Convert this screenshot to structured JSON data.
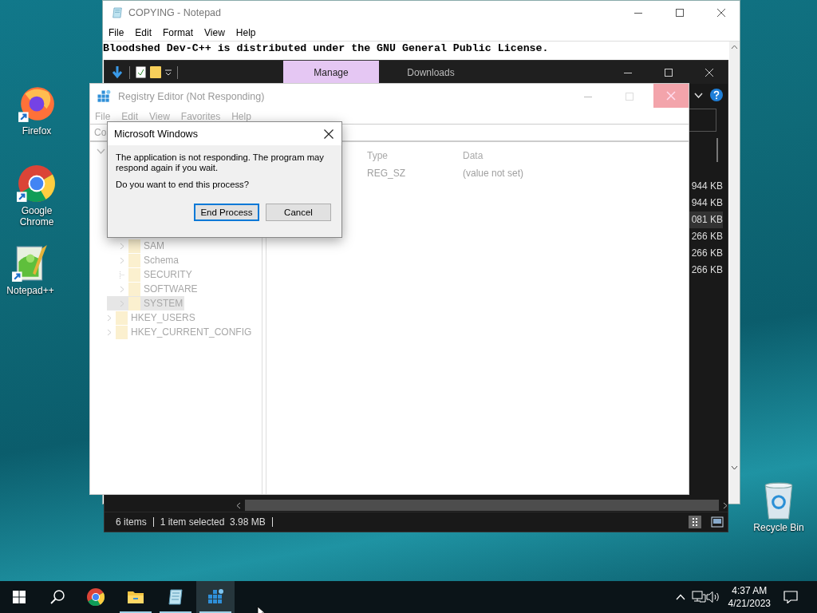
{
  "desktop_icons": [
    {
      "label": "Firefox",
      "kind": "firefox"
    },
    {
      "label": "Google Chrome",
      "kind": "chrome"
    },
    {
      "label": "Notepad++",
      "kind": "notepadpp"
    },
    {
      "label": "Recycle Bin",
      "kind": "recycle"
    }
  ],
  "notepad": {
    "title": "COPYING - Notepad",
    "menu": [
      "File",
      "Edit",
      "Format",
      "View",
      "Help"
    ],
    "lines": [
      "Bloodshed Dev-C++ is distributed under the GNU General Public License."
    ]
  },
  "explorer": {
    "tabs": [
      {
        "label": "Manage",
        "selected": true
      },
      {
        "label": "Downloads",
        "selected": false
      }
    ],
    "sizes": [
      {
        "text": "944 KB",
        "selected": false
      },
      {
        "text": "944 KB",
        "selected": false
      },
      {
        "text": "081 KB",
        "selected": true
      },
      {
        "text": "266 KB",
        "selected": false
      },
      {
        "text": "266 KB",
        "selected": false
      },
      {
        "text": "266 KB",
        "selected": false
      }
    ],
    "status": [
      "6 items",
      "1 item selected  3.98 MB"
    ]
  },
  "regedit": {
    "title": "Registry Editor (Not Responding)",
    "menu": [
      "File",
      "Edit",
      "View",
      "Favorites",
      "Help"
    ],
    "address": "Co",
    "tree": [
      {
        "children": [
          {
            "label": "SAM",
            "expandable": true,
            "selected": false
          },
          {
            "label": "Schema",
            "expandable": true,
            "selected": false
          },
          {
            "label": "SECURITY",
            "expandable": false,
            "selected": false
          },
          {
            "label": "SOFTWARE",
            "expandable": true,
            "selected": false
          },
          {
            "label": "SYSTEM",
            "expandable": true,
            "selected": true
          }
        ]
      },
      {
        "label": "HKEY_USERS",
        "expandable": true,
        "selected": false
      },
      {
        "label": "HKEY_CURRENT_CONFIG",
        "expandable": true,
        "selected": false
      }
    ],
    "columns": [
      "Type",
      "Data"
    ],
    "rows": [
      [
        "REG_SZ",
        "(value not set)"
      ]
    ]
  },
  "dialog": {
    "title": "Microsoft Windows",
    "message": "The application is not responding. The program may respond again if you wait.",
    "question": "Do you want to end this process?",
    "buttons": [
      {
        "label": "End Process",
        "selected": true
      },
      {
        "label": "Cancel",
        "selected": false
      }
    ]
  },
  "taskbar": {
    "apps": [
      {
        "kind": "chrome",
        "active": false,
        "running": false
      },
      {
        "kind": "explorer",
        "active": false,
        "running": true
      },
      {
        "kind": "notepad",
        "active": false,
        "running": true
      },
      {
        "kind": "regedit",
        "active": true,
        "running": true
      }
    ],
    "time": "4:37 AM",
    "date": "4/21/2023"
  }
}
